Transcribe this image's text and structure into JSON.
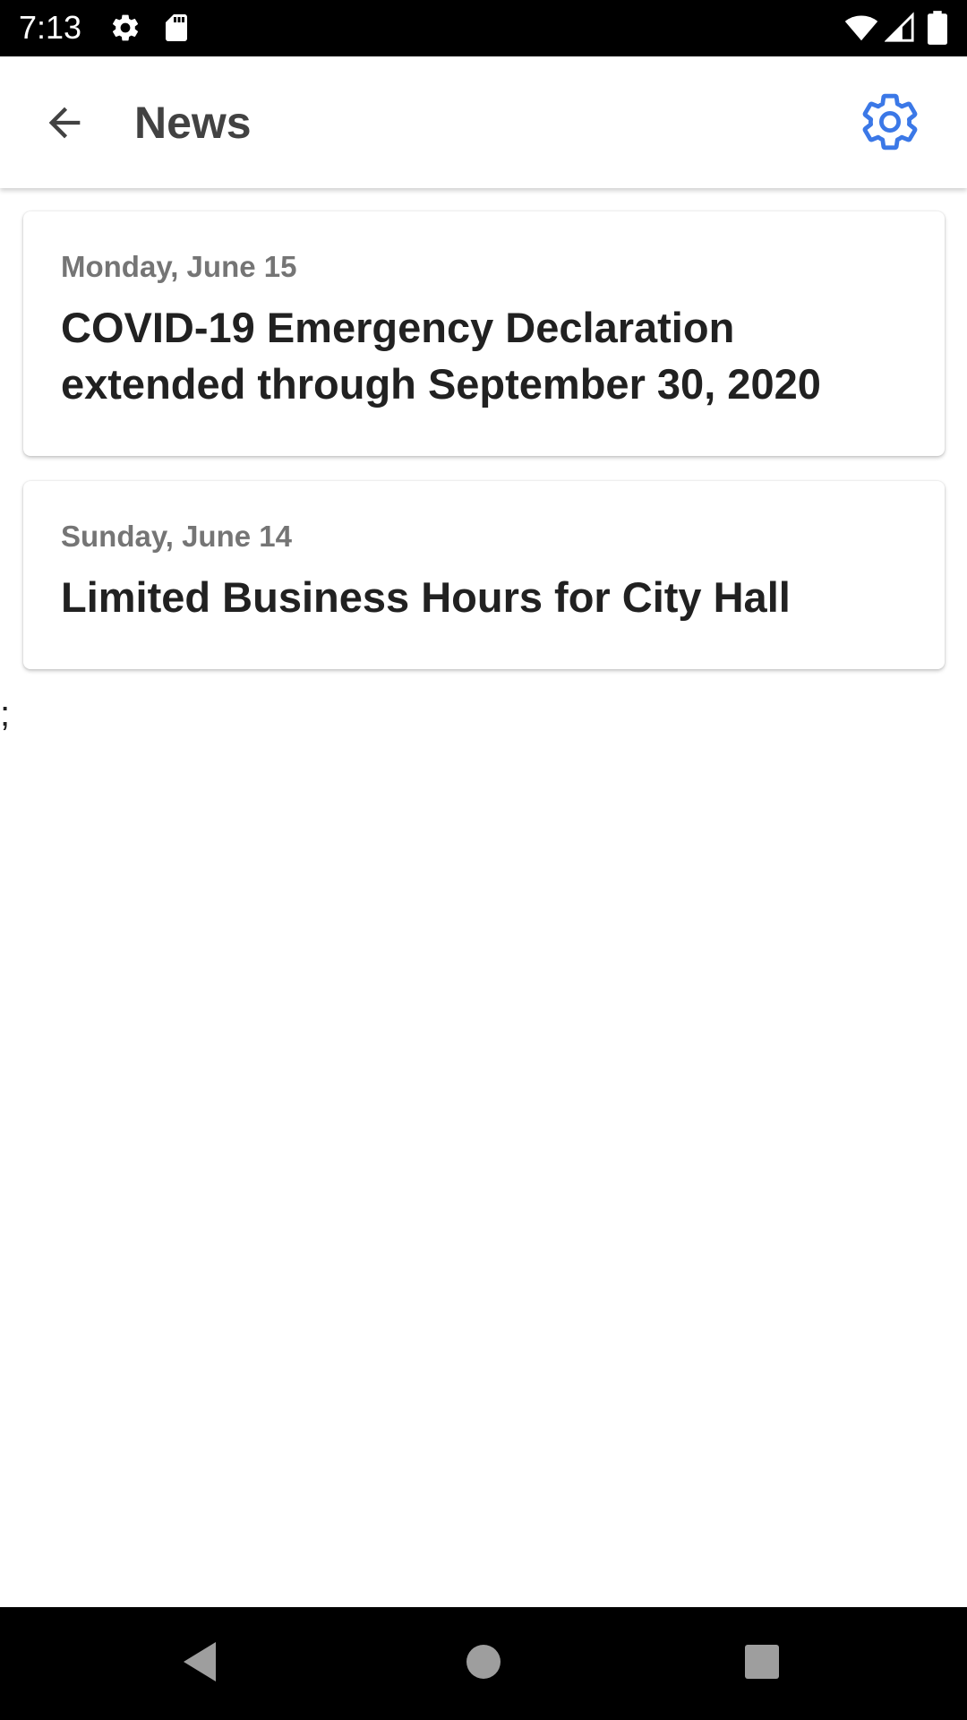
{
  "status_bar": {
    "time": "7:13",
    "icons": [
      "settings-gear-icon",
      "sd-card-icon",
      "wifi-icon",
      "cell-signal-icon",
      "battery-icon"
    ]
  },
  "app_bar": {
    "title": "News",
    "back_icon": "arrow-back-icon",
    "settings_icon": "gear-icon",
    "accent_color": "#3b78e7"
  },
  "news": {
    "items": [
      {
        "date": "Monday, June 15",
        "title": "COVID-19 Emergency Declaration extended through September 30, 2020"
      },
      {
        "date": "Sunday, June 14",
        "title": "Limited Business Hours for City Hall"
      }
    ]
  },
  "stray_text": ";",
  "nav_bar": {
    "buttons": [
      "back-triangle-icon",
      "home-circle-icon",
      "recents-square-icon"
    ]
  }
}
